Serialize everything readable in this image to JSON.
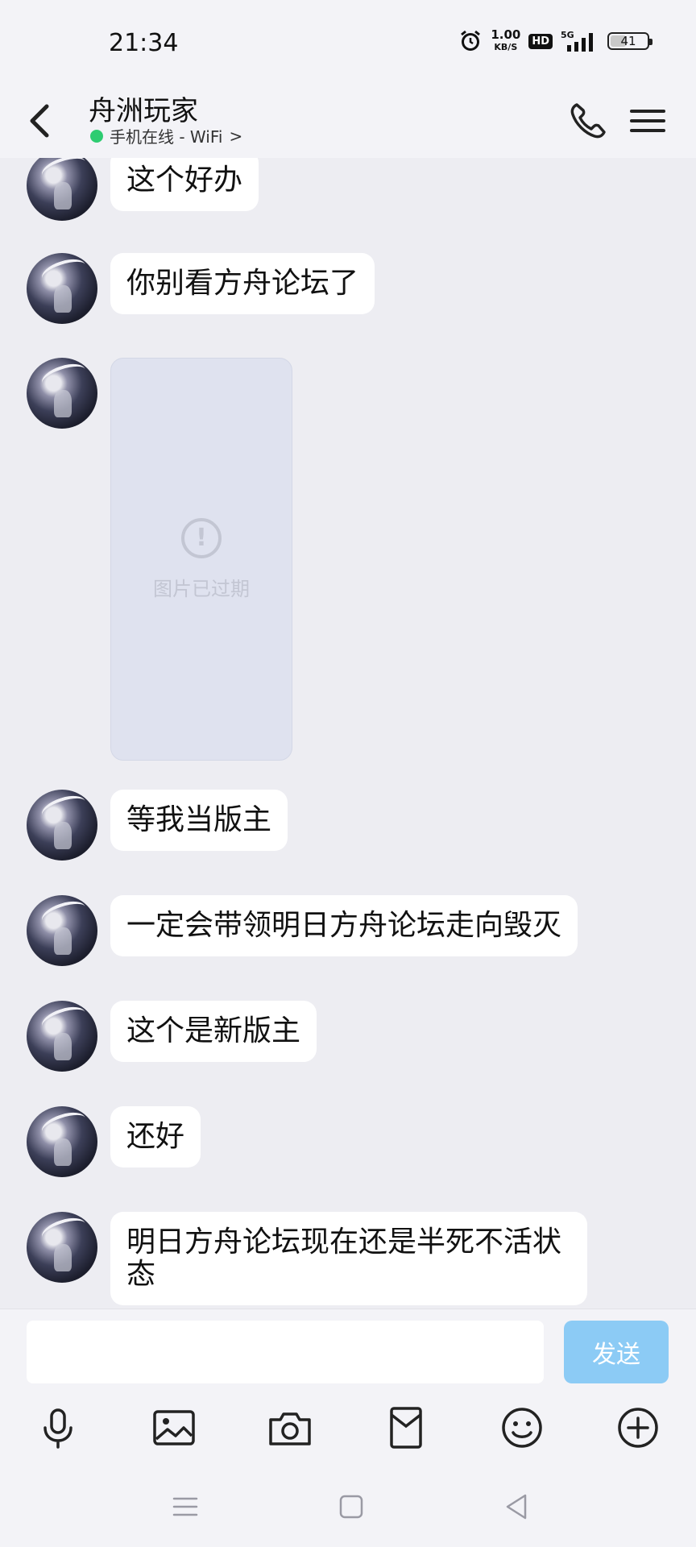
{
  "status_bar": {
    "time": "21:34",
    "net_speed_value": "1.00",
    "net_speed_unit": "KB/S",
    "hd_badge": "HD",
    "signal_label": "5G",
    "battery_level": "41"
  },
  "header": {
    "title": "舟洲玩家",
    "status": "手机在线 - WiFi",
    "status_chevron": ">"
  },
  "messages": [
    {
      "type": "text",
      "text": "这个好办"
    },
    {
      "type": "text",
      "text": "你别看方舟论坛了"
    },
    {
      "type": "image_expired",
      "icon": "!",
      "text": "图片已过期"
    },
    {
      "type": "text",
      "text": "等我当版主"
    },
    {
      "type": "text",
      "text": "一定会带领明日方舟论坛走向毁灭"
    },
    {
      "type": "text",
      "text": "这个是新版主"
    },
    {
      "type": "text",
      "text": "还好"
    },
    {
      "type": "text",
      "text": "明日方舟论坛现在还是半死不活状态"
    }
  ],
  "composer": {
    "input_value": "",
    "send_label": "发送"
  },
  "colors": {
    "background": "#ededf2",
    "send_button": "#8ccbf5",
    "online_dot": "#2ecc71"
  }
}
